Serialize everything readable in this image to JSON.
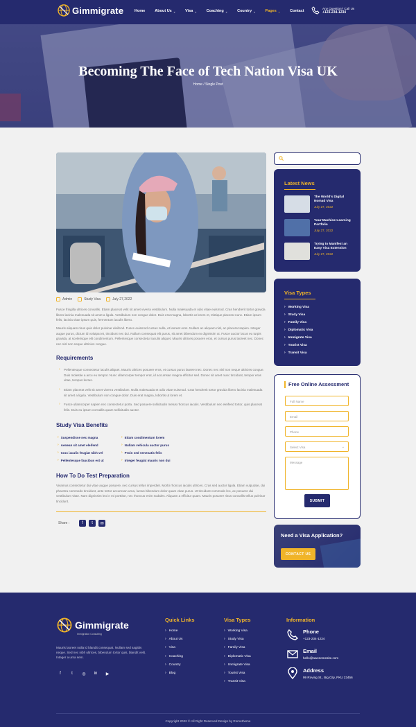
{
  "brand": {
    "name": "Gimmigrate",
    "tagline": "Immigration Consulting"
  },
  "nav": {
    "items": [
      {
        "label": "Home",
        "dropdown": false,
        "active": false
      },
      {
        "label": "About Us",
        "dropdown": true,
        "active": false
      },
      {
        "label": "Visa",
        "dropdown": true,
        "active": false
      },
      {
        "label": "Coaching",
        "dropdown": true,
        "active": false
      },
      {
        "label": "Country",
        "dropdown": true,
        "active": false
      },
      {
        "label": "Pages",
        "dropdown": true,
        "active": true
      },
      {
        "label": "Contact",
        "dropdown": false,
        "active": false
      }
    ]
  },
  "contact_header": {
    "question": "Any Question? Call Us",
    "phone": "+123-234-1234"
  },
  "hero": {
    "title": "Becoming The Face of Tech Nation Visa UK",
    "breadcrumb": "Home / Single Post"
  },
  "post": {
    "meta": {
      "author": "Admin",
      "category": "Study Visa",
      "date": "July 27,2022"
    },
    "intro_1": "Fusce fringilla ultrices convallis. Etiam placerat velit sit amet viverra vestibulum. Nulla malesuada et odio vitae euismod. Cras hendrerit tortor gravida libero lacinia malesuada sit amet a ligula. Vestibulum non congue dolor. Duis erat magna, lobortis ut lorem et, tristique placerat nunc. Etiam ipsum felis, lacinia vitae ipsum quis, fermentum iaculis libero.",
    "intro_2": "Mauris aliquam risus quis dolor pulvinar eleifend. Fusce euismod cursus nulla, et laoreet eros. Nullam ac aliquam nisl, ac placerat sapien. Integer augue purus, dictum id volutpat et, tincidunt nec dui. Nullam consequat elit purus, sit amet bibendum ex dignissim ut. Fusce auctor lacus eu turpis gravida, at scelerisque elit condimentum. Pellentesque consectetur iaculis aliquet. Mauris ultrices posuere eros, et cursus purus laoreet nec. Donec nec nisl non neque ultricies congue.",
    "requirements_title": "Requirements",
    "requirements": [
      "Pellentesque consectetur iaculis aliquet. Mauris ultrices posuere eros, et cursus purus laoreet nec. Donec nec nisl non neque ultricies congue. Duis molestie a arcu eu tempor. Nunc ullamcorper tempor erat, id accumsan magna efficitur sed. Donec sit amet nunc tincidunt, tempor eros vitae, tempus lectus.",
      "Etiam placerat velit sit amet viverra vestibulum. Nulla malesuada et odio vitae euismod. Cras hendrerit tortor gravida libero lacinia malesuada sit amet a ligula. Vestibulum non congue dolor. Duis erat magna, lobortis ut lorem et.",
      "Fusce ullamcorper sapien nec consectetur porta. Sed posuere sollicitudin metus rhoncus iaculis. Vestibulum nec eleifend tortor, quis placerat felis. Duis eu ipsum convallis quam sollicitudin auctor."
    ],
    "benefits_title": "Study Visa Benefits",
    "benefits_left": [
      "Suspendisse nec magna",
      "Aenean sit amet eleifend",
      "Cras iaculis feugiat nibh vel",
      "Pellentesque faucibus est ut"
    ],
    "benefits_right": [
      "Etiam condimentum lorem",
      "Nullam vehicula auctor purus",
      "Proin sed venenatis felis",
      "Integer feugiat mauris non dui"
    ],
    "prep_title": "How To Do Test Preparation",
    "prep_text": "Vivamus consectetur dui vitae augue posuere, nec cursus tellus imperdiet. Morbi rhoncus iaculis ultrices. Cras sed auctor ligula. Etiam vulputate, dui pharetra commodo tincidunt, ante tortor accumsan urna, luctus bibendum dolor quam vitae purus. Ut tincidunt commodo leo, ac posuere dui vestibulum vitae. Nam dignissim leo in mi porttitor, nec rhoncus enim sodales. Aliquam a efficitur quam. Mauris posuere risus convallis tellus pulvinar tincidunt.",
    "share_label": "Share :"
  },
  "sidebar": {
    "search_placeholder": "",
    "latest_news_title": "Latest News",
    "latest_news": [
      {
        "title": "The World's Digital Nomad Visa",
        "date": "July 27, 2022"
      },
      {
        "title": "Your Machine Learning Portfolio",
        "date": "July 27, 2022"
      },
      {
        "title": "Trying to Manifest an Easy Visa Extension",
        "date": "July 27, 2022"
      }
    ],
    "visa_types_title": "Visa Types",
    "visa_types": [
      "Working Visa",
      "Study Visa",
      "Family Visa",
      "Diplomatic Visa",
      "Immigrate Visa",
      "Tourist Visa",
      "Transit Visa"
    ],
    "assessment": {
      "title": "Free Online Assessment",
      "fields": [
        "Full Name",
        "Email",
        "Phone",
        "Select Visa",
        "Message"
      ],
      "submit": "SUBMIT"
    },
    "cta": {
      "title": "Need a Visa Application?",
      "button": "CONTACT US"
    }
  },
  "footer": {
    "description": "Mauris laoreet nulla id blandit consequat. Nullam sed sagittis neque. Sed nec nibh ultrices, bibendum tortor quis, blandit velit. Integer a urna sem.",
    "quick_links_title": "Quick Links",
    "quick_links": [
      "Home",
      "About Us",
      "Visa",
      "Coaching",
      "Country",
      "Blog"
    ],
    "visa_types_title": "Visa Types",
    "visa_types": [
      "Working Visa",
      "Study Visa",
      "Family Visa",
      "Diplomatic Visa",
      "Immigrate Visa",
      "Tourist Visa",
      "Transit Visa"
    ],
    "info_title": "Information",
    "info": [
      {
        "label": "Phone",
        "value": "+123-234-1234",
        "icon": "phone-icon"
      },
      {
        "label": "Email",
        "value": "hello@awesomesite.com",
        "icon": "mail-icon"
      },
      {
        "label": "Address",
        "value": "99 Roving St., Big City, PKU 23456",
        "icon": "location-pin-icon"
      }
    ],
    "copyright": "Copyright 2022 © All Right Reserved Design by Rometheme"
  },
  "colors": {
    "primary": "#252a6e",
    "accent": "#f0b429"
  }
}
